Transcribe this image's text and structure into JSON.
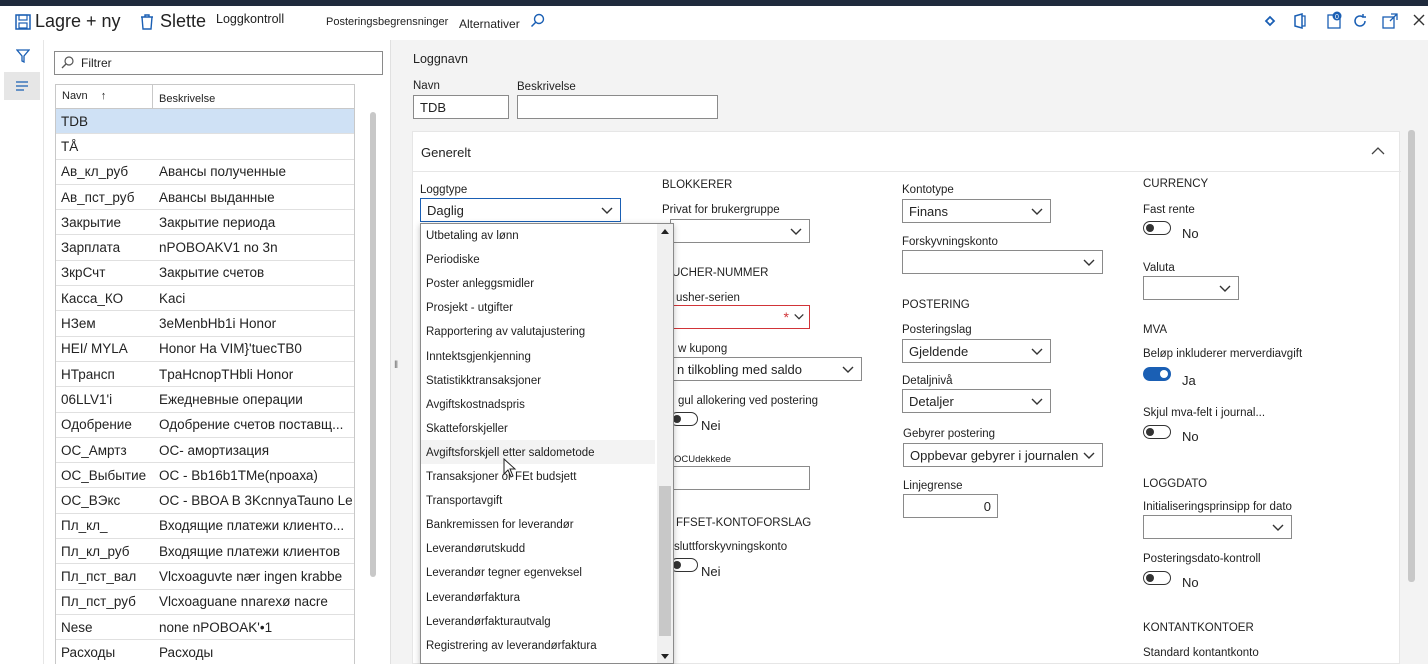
{
  "toolbar": {
    "save_new": "Lagre + ny",
    "delete": "Slette",
    "log_control": "Loggkontroll",
    "posting_restrictions": "Posteringsbegrensninger",
    "options": "Alternativer"
  },
  "list": {
    "filter_placeholder": "Filtrer",
    "col_name": "Navn",
    "col_desc": "Beskrivelse",
    "rows": [
      {
        "name": "TDB",
        "desc": ""
      },
      {
        "name": "TÅ",
        "desc": ""
      },
      {
        "name": "Ав_кл_руб",
        "desc": "Авансы полученные"
      },
      {
        "name": "Ав_пст_руб",
        "desc": "Авансы выданные"
      },
      {
        "name": "Закрытие",
        "desc": "Закрытие периода"
      },
      {
        "name": "Зарплата",
        "desc": "nPOBOAKV1 no 3n"
      },
      {
        "name": "ЗкрСчт",
        "desc": "Закрытие счетов"
      },
      {
        "name": "Касса_КО",
        "desc": "Kaci"
      },
      {
        "name": "НЗем",
        "desc": "3eMenbHb1i Honor"
      },
      {
        "name": "HEI/ MYLA",
        "desc": "Honor Ha VIM}'tuecTB0"
      },
      {
        "name": "НТрансп",
        "desc": "TpaHcnopTHbli Honor"
      },
      {
        "name": "06LLV1'i",
        "desc": "Ежедневные операции"
      },
      {
        "name": "Одобрение",
        "desc": "Одобрение счетов поставщ..."
      },
      {
        "name": "ОС_Амртз",
        "desc": "ОС-   амортизация"
      },
      {
        "name": "ОС_Выбытие",
        "desc": "ОС - Bb16b1TMe(nроаха)"
      },
      {
        "name": "ОС_ВЭкс",
        "desc": "ОС -   BBOA B 3KcnnyaTauno Leilighet"
      },
      {
        "name": "Пл_кл_",
        "desc": "Входящие платежи клиенто..."
      },
      {
        "name": "Пл_кл_руб",
        "desc": "Входящие платежи клиентов"
      },
      {
        "name": "Пл_пст_вал",
        "desc": "Vlcxoaguvte nær ingen krabbe"
      },
      {
        "name": "Пл_пст_руб",
        "desc": "Vlcxoaguane nnarexø nacre"
      },
      {
        "name": "Nese",
        "desc": "none nPOBOAK'•1"
      },
      {
        "name": "Расходы",
        "desc": "Расходы"
      }
    ]
  },
  "detail": {
    "header": "Loggnavn",
    "name_label": "Navn",
    "name_value": "TDB",
    "desc_label": "Beskrivelse",
    "desc_value": "",
    "general": "Generelt",
    "logtype_label": "Loggtype",
    "logtype_value": "Daglig",
    "blocker": "BLOKKERER",
    "private_label": "Privat for brukergruppe",
    "voucher_section": "UCHER-NUMMER",
    "voucher_series_label": "usher-serien",
    "new_voucher_label": "w kupong",
    "new_voucher_value": "n tilkobling med saldo",
    "alloc_label": "gul allokering ved postering",
    "alloc_value": "Nei",
    "uncovered_label": "OCUdekkede",
    "offset_section": "FFSET-KONTOFORSLAG",
    "offset_account_label": "sluttforskyvningskonto",
    "offset_value": "Nei",
    "accounttype_label": "Kontotype",
    "accounttype_value": "Finans",
    "offsetacct_label": "Forskyvningskonto",
    "posting_section": "POSTERING",
    "posting_layer_label": "Posteringslag",
    "posting_layer_value": "Gjeldende",
    "detail_level_label": "Detaljnivå",
    "detail_level_value": "Detaljer",
    "fees_label": "Gebyrer postering",
    "fees_value": "Oppbevar gebyrer i journalen",
    "line_limit_label": "Linjegrense",
    "line_limit_value": "0",
    "currency_section": "CURRENCY",
    "fixed_rate_label": "Fast rente",
    "fixed_rate_value": "No",
    "currency_label": "Valuta",
    "mva_section": "MVA",
    "incl_vat_label": "Beløp inkluderer merverdiavgift",
    "incl_vat_value": "Ja",
    "hide_vat_label": "Skjul mva-felt i journal...",
    "hide_vat_value": "No",
    "logdate_section": "LOGGDATO",
    "init_principle_label": "Initialiseringsprinsipp for dato",
    "posting_date_ctrl_label": "Posteringsdato-kontroll",
    "posting_date_ctrl_value": "No",
    "cash_section": "KONTANTKONTOER",
    "std_cash_label": "Standard kontantkonto"
  },
  "dropdown": {
    "items": [
      "Utbetaling av lønn",
      "Periodiske",
      "Poster anleggsmidler",
      "Prosjekt - utgifter",
      "Rapportering av valutajustering",
      "Inntektsgjenkjenning",
      "Statistikktransaksjoner",
      "Avgiftskostnadspris",
      "Skatteforskjeller",
      "Avgiftsforskjell etter saldometode",
      "Transaksjoner or FEt budsjett",
      "Transportavgift",
      "Bankremissen for leverandør",
      "Leverandørutskudd",
      "Leverandør tegner egenveksel",
      "Leverandørfaktura",
      "Leverandørfakturautvalg",
      "Registrering av leverandørfaktura"
    ]
  },
  "colors": {
    "accent": "#1a5fb4",
    "selected_row": "#cfe1f5",
    "error": "#d13438"
  }
}
